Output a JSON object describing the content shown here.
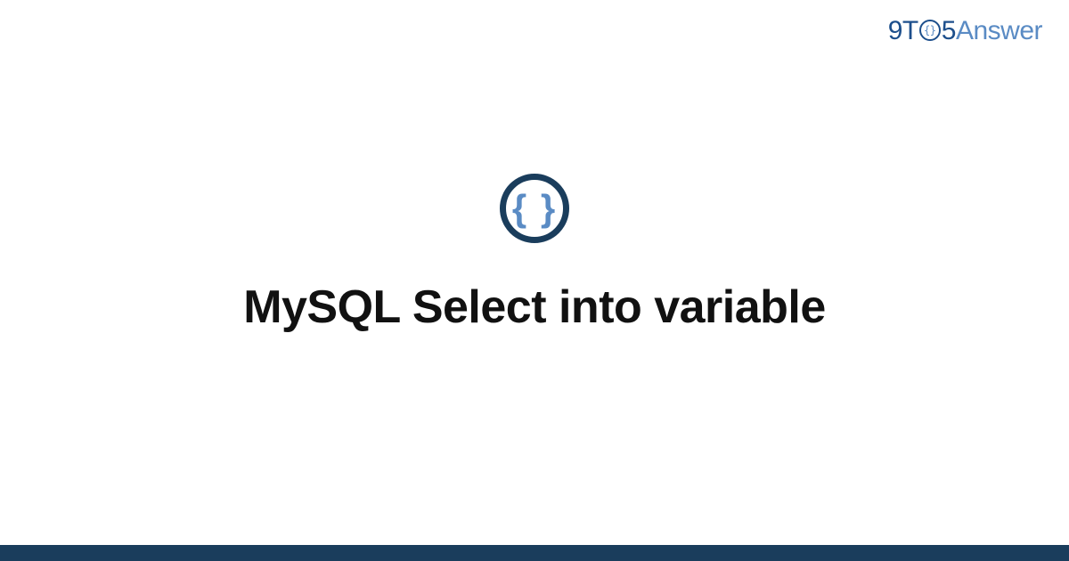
{
  "logo": {
    "part1": "9T",
    "part_o_inner": "{}",
    "part2": "5",
    "part3": "Answer"
  },
  "icon": {
    "braces": "{ }"
  },
  "title": "MySQL Select into variable"
}
